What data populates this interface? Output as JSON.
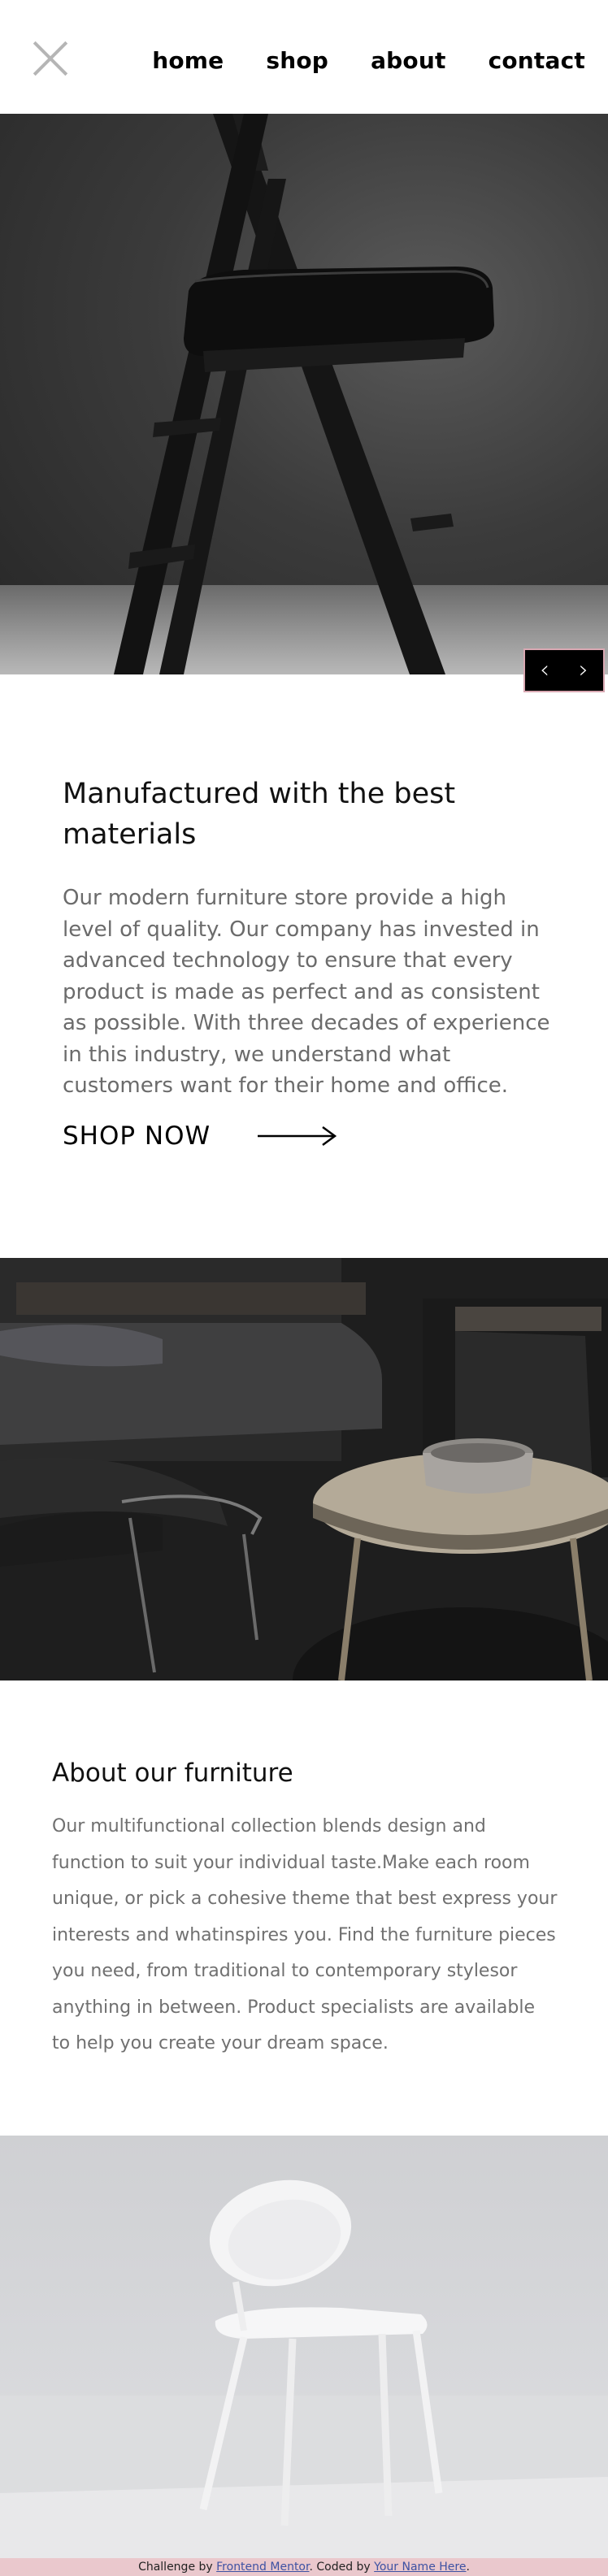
{
  "header": {
    "close_icon": "close-icon",
    "nav": [
      {
        "label": "home"
      },
      {
        "label": "shop"
      },
      {
        "label": "about"
      },
      {
        "label": "contact"
      }
    ]
  },
  "hero": {
    "prev_icon": "chevron-left-icon",
    "next_icon": "chevron-right-icon",
    "prev_glyph": "‹",
    "next_glyph": "›"
  },
  "section_materials": {
    "title": "Manufactured with the best materials",
    "body": "Our modern furniture store provide a high level of quality. Our company has invested in advanced technology to ensure that every product is made as perfect and as consistent as possible. With three decades of experience in this industry, we understand what customers want for their home and office.",
    "cta_label": "SHOP NOW",
    "cta_icon": "arrow-right-icon"
  },
  "section_about": {
    "title": "About our furniture",
    "body": "Our multifunctional collection blends design and function to suit your individual taste.Make each room unique, or pick a cohesive theme that best express your interests and whatinspires you. Find the furniture pieces you need, from traditional to contemporary stylesor anything in between. Product specialists are available to help you create your dream space."
  },
  "attribution": {
    "prefix": "Challenge by ",
    "link1": "Frontend Mentor",
    "middle": ". Coded by ",
    "link2": "Your Name Here",
    "suffix": "."
  },
  "colors": {
    "accent_pink": "#eac8cd",
    "link_blue": "#3e52a3",
    "body_gray": "#6b6b6b"
  }
}
